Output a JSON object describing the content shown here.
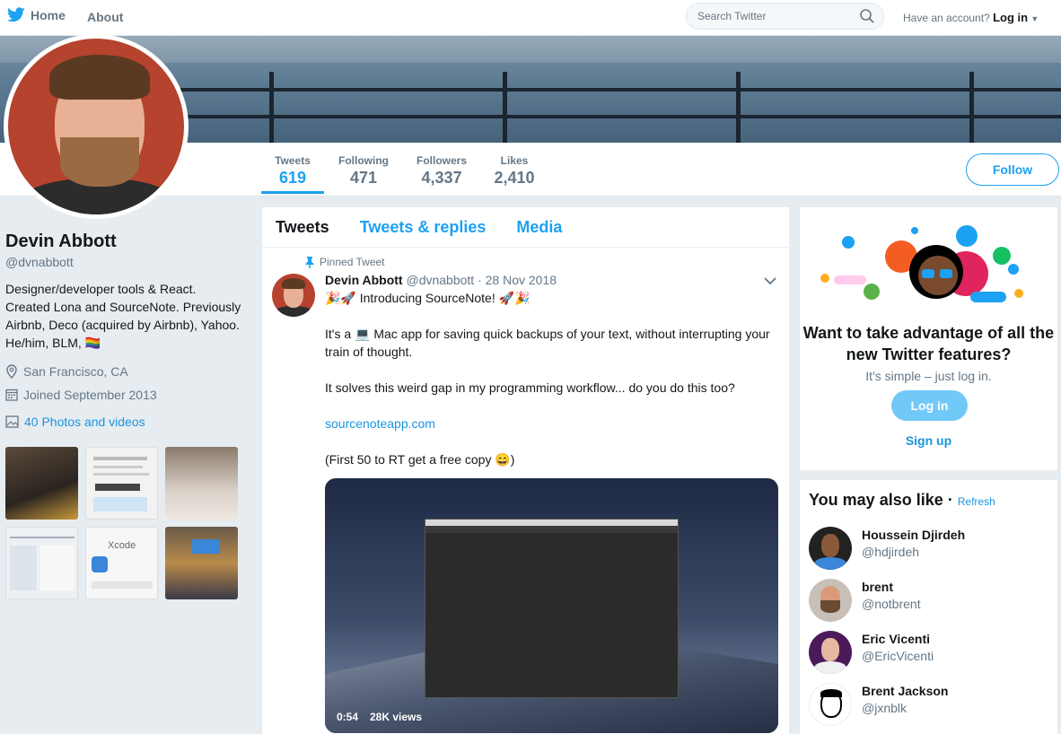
{
  "nav": {
    "home_label": "Home",
    "about_label": "About",
    "search_placeholder": "Search Twitter",
    "account_prompt": "Have an account?",
    "login_label": "Log in"
  },
  "profile_nav": {
    "stats": [
      {
        "label": "Tweets",
        "value": "619"
      },
      {
        "label": "Following",
        "value": "471"
      },
      {
        "label": "Followers",
        "value": "4,337"
      },
      {
        "label": "Likes",
        "value": "2,410"
      }
    ],
    "follow_label": "Follow"
  },
  "profile": {
    "name": "Devin Abbott",
    "handle": "@dvnabbott",
    "bio": "Designer/developer tools & React. Created Lona and SourceNote. Previously Airbnb, Deco (acquired by Airbnb), Yahoo. He/him, BLM, 🏳️‍🌈",
    "location": "San Francisco, CA",
    "joined": "Joined September 2013",
    "photos_label": "40 Photos and videos"
  },
  "timeline": {
    "tabs": [
      "Tweets",
      "Tweets & replies",
      "Media"
    ],
    "pinned_label": "Pinned Tweet",
    "tweet": {
      "author": "Devin Abbott",
      "handle_date": "@dvnabbott · 28 Nov 2018",
      "line1": "🎉🚀 Introducing SourceNote! 🚀🎉",
      "line2": "It's a 💻 Mac app for saving quick backups of your text, without interrupting your train of thought.",
      "line3": "It solves this weird gap in my programming workflow... do you do this too?",
      "link": "sourcenoteapp.com",
      "line4": "(First 50 to RT get a free copy 😄)",
      "video_duration": "0:54",
      "video_views": "28K views"
    }
  },
  "signup_card": {
    "headline": "Want to take advantage of all the new Twitter features?",
    "subtext": "It's simple – just log in.",
    "login_label": "Log in",
    "signup_label": "Sign up"
  },
  "suggestions": {
    "title": "You may also like",
    "refresh_label": "Refresh",
    "users": [
      {
        "name": "Houssein Djirdeh",
        "handle": "@hdjirdeh"
      },
      {
        "name": "brent",
        "handle": "@notbrent"
      },
      {
        "name": "Eric Vicenti",
        "handle": "@EricVicenti"
      },
      {
        "name": "Brent Jackson",
        "handle": "@jxnblk"
      }
    ]
  },
  "colors": {
    "accent": "#1da1f2",
    "link": "#1b95e0",
    "background": "#e6ecf0"
  }
}
